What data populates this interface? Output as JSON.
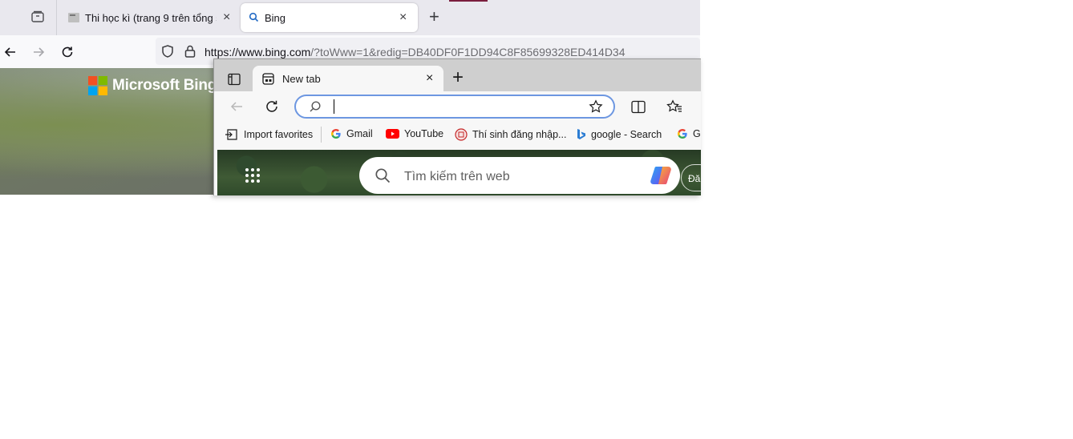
{
  "bg_browser": {
    "tabs": [
      {
        "title": "Thi học kì (trang 9 trên tổng số",
        "close": "×"
      },
      {
        "title": "Bing",
        "close": "×"
      }
    ],
    "new_tab": "+",
    "url_host": "https://www.bing.com",
    "url_rest": "/?toWww=1&redig=DB40DF0F1DD94C8F85699328ED414D34",
    "logo_text": "Microsoft Bing"
  },
  "fg_browser": {
    "tab_title": "New tab",
    "tab_close": "×",
    "new_tab": "+",
    "favorites": [
      {
        "label": "Import favorites",
        "icon": "import-icon"
      },
      {
        "label": "Gmail",
        "icon": "google-icon"
      },
      {
        "label": "YouTube",
        "icon": "youtube-icon"
      },
      {
        "label": "Thí sinh đăng nhập...",
        "icon": "emblem-icon"
      },
      {
        "label": "google - Search",
        "icon": "bing-icon"
      },
      {
        "label": "G",
        "icon": "google-icon"
      }
    ],
    "search_placeholder": "Tìm kiếm trên web",
    "signin_text": "Đă"
  },
  "colors": {
    "address_focus": "#6d97e1",
    "youtube_red": "#ff0000",
    "bg_tab_accent": "#7a1d3d"
  }
}
